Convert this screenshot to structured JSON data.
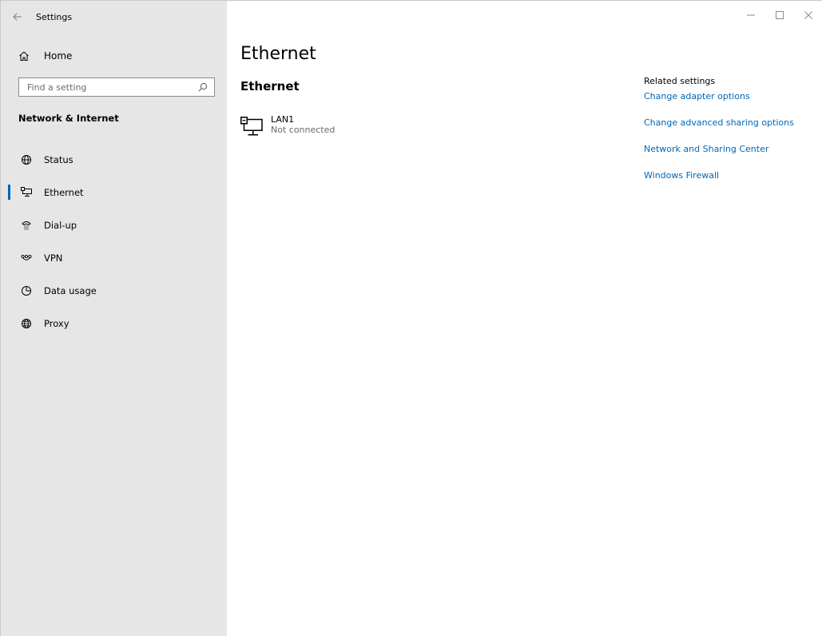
{
  "window": {
    "title": "Settings"
  },
  "sidebar": {
    "home_label": "Home",
    "search_placeholder": "Find a setting",
    "section_header": "Network & Internet",
    "items": [
      {
        "label": "Status",
        "icon": "globe-status-icon"
      },
      {
        "label": "Ethernet",
        "icon": "ethernet-icon",
        "selected": true
      },
      {
        "label": "Dial-up",
        "icon": "dialup-icon"
      },
      {
        "label": "VPN",
        "icon": "vpn-icon"
      },
      {
        "label": "Data usage",
        "icon": "data-usage-icon"
      },
      {
        "label": "Proxy",
        "icon": "globe-icon"
      }
    ]
  },
  "main": {
    "title": "Ethernet",
    "subtitle": "Ethernet",
    "adapter": {
      "name": "LAN1",
      "status": "Not connected"
    },
    "related": {
      "heading": "Related settings",
      "links": [
        "Change adapter options",
        "Change advanced sharing options",
        "Network and Sharing Center",
        "Windows Firewall"
      ]
    }
  },
  "colors": {
    "sidebar_bg": "#e6e6e6",
    "accent": "#0063b1",
    "link": "#0066b4"
  }
}
